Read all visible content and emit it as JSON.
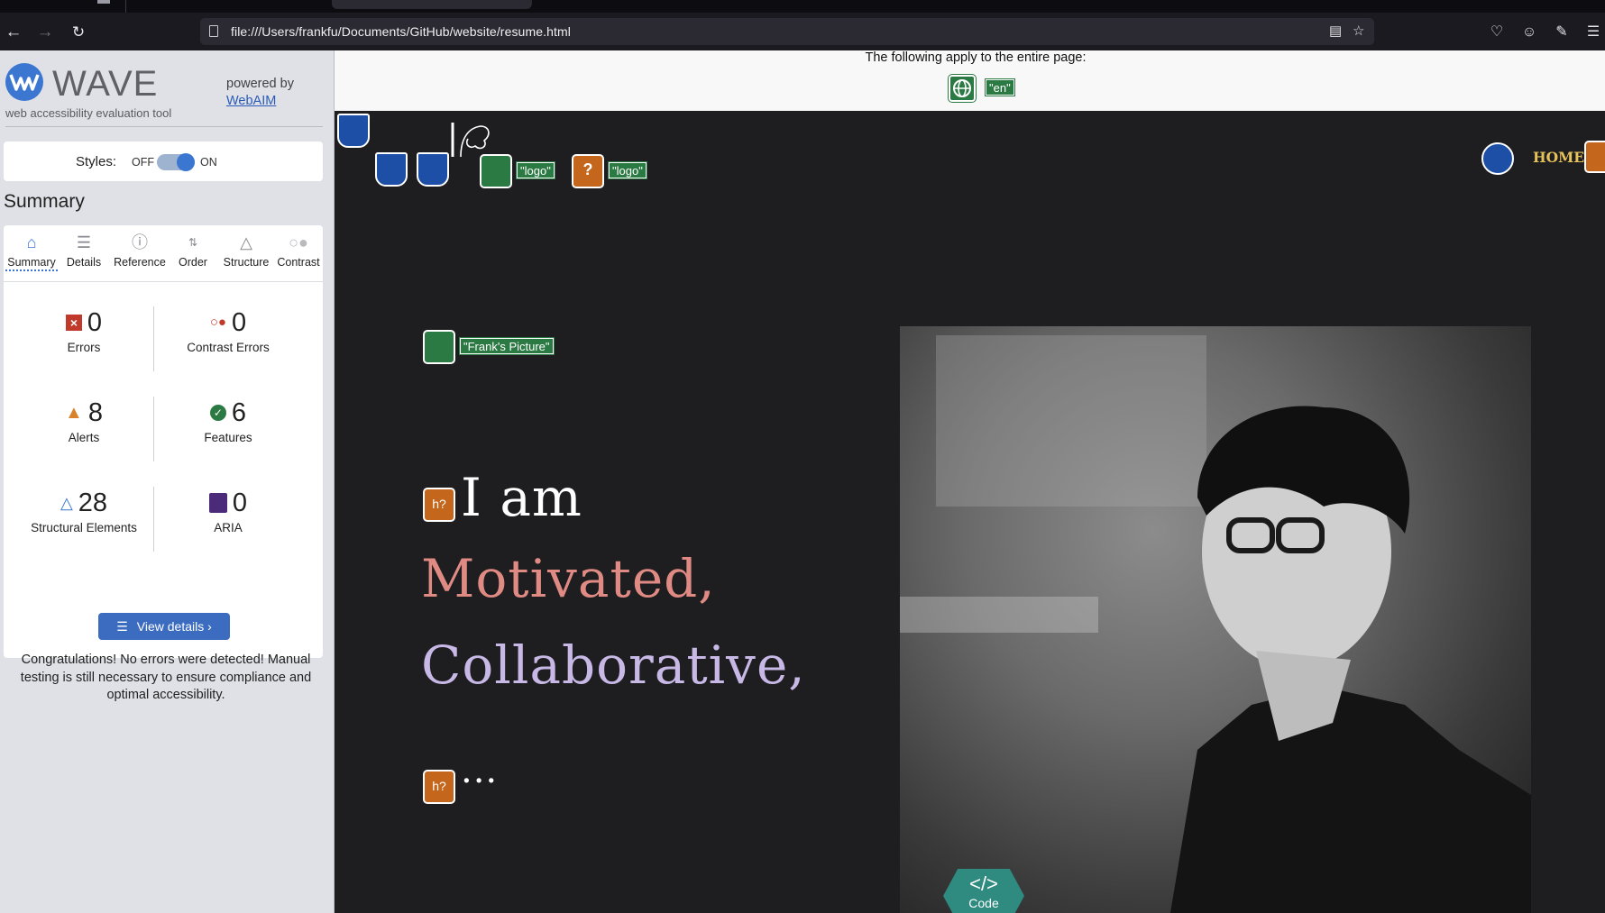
{
  "browser": {
    "url": "file:///Users/frankfu/Documents/GitHub/website/resume.html",
    "icons": [
      "back-icon",
      "forward-icon",
      "reload-icon",
      "page-icon",
      "reader-icon",
      "bookmark-star-icon",
      "pocket-icon",
      "account-icon",
      "extensions-icon",
      "menu-icon"
    ]
  },
  "wave": {
    "title": "WAVE",
    "subtitle": "web accessibility evaluation tool",
    "powered_by": "powered by",
    "webaim": "WebAIM",
    "styles_label": "Styles:",
    "styles_off": "OFF",
    "styles_on": "ON",
    "summary_heading": "Summary",
    "tabs": [
      {
        "label": "Summary",
        "icon": "home-icon"
      },
      {
        "label": "Details",
        "icon": "list-icon"
      },
      {
        "label": "Reference",
        "icon": "info-icon"
      },
      {
        "label": "Order",
        "icon": "order-icon"
      },
      {
        "label": "Structure",
        "icon": "structure-icon"
      },
      {
        "label": "Contrast",
        "icon": "contrast-icon"
      }
    ],
    "stats": {
      "errors": {
        "value": "0",
        "label": "Errors"
      },
      "contrast_errors": {
        "value": "0",
        "label": "Contrast Errors"
      },
      "alerts": {
        "value": "8",
        "label": "Alerts"
      },
      "features": {
        "value": "6",
        "label": "Features"
      },
      "structural": {
        "value": "28",
        "label": "Structural Elements"
      },
      "aria": {
        "value": "0",
        "label": "ARIA"
      }
    },
    "view_details": "View details ›",
    "congrats": "Congratulations! No errors were detected! Manual testing is still necessary to ensure compliance and optimal accessibility.",
    "colors": {
      "accent": "#3b77d0",
      "error": "#c0392b",
      "alert": "#d9822b",
      "feature": "#2c7a43",
      "aria": "#4b2a7a"
    }
  },
  "page": {
    "apply_text": "The following apply to the entire page:",
    "lang_tag": "\"en\"",
    "logo_tag_1": "\"logo\"",
    "logo_tag_2": "\"logo\"",
    "picture_tag": "\"Frank's Picture\"",
    "home": "HOME",
    "hero": {
      "line1": "I am",
      "line2": "Motivated,",
      "line3": "Collaborative,",
      "line4": "..."
    },
    "heading_badge": "h?",
    "code_label": "Code",
    "code_glyph": "</>",
    "colors": {
      "motivated": "#e08a84",
      "collaborative": "#c7b8e6",
      "home": "#e6c25a"
    }
  }
}
